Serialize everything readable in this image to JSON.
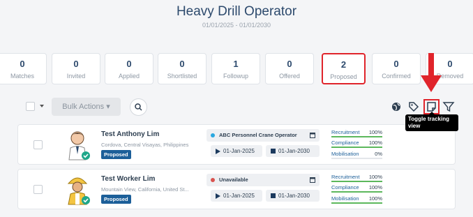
{
  "header": {
    "title": "Heavy Drill Operator",
    "date_range": "01/01/2025 - 01/01/2030"
  },
  "stats": [
    {
      "count": "0",
      "label": "Matches"
    },
    {
      "count": "0",
      "label": "Invited"
    },
    {
      "count": "0",
      "label": "Applied"
    },
    {
      "count": "0",
      "label": "Shortlisted"
    },
    {
      "count": "1",
      "label": "Followup"
    },
    {
      "count": "0",
      "label": "Offered"
    },
    {
      "count": "2",
      "label": "Proposed"
    },
    {
      "count": "0",
      "label": "Confirmed"
    },
    {
      "count": "0",
      "label": "Removed"
    }
  ],
  "toolbar": {
    "bulk_actions_label": "Bulk Actions ▾"
  },
  "tooltip": {
    "text": "Toggle tracking view"
  },
  "workers": [
    {
      "name": "Test Anthony Lim",
      "location": "Cordova, Central Visayas, Philippines",
      "status": "Proposed",
      "project": "ABC Personnel Crane Operator",
      "project_dot_color": "#29a8e0",
      "start_date": "01-Jan-2025",
      "end_date": "01-Jan-2030",
      "metrics": [
        {
          "label": "Recruitment",
          "value": "100%",
          "level": 1.0
        },
        {
          "label": "Compliance",
          "value": "100%",
          "level": 1.0
        },
        {
          "label": "Mobilisation",
          "value": "0%",
          "level": 0.0
        }
      ]
    },
    {
      "name": "Test Worker Lim",
      "location": "Mountain View, California, United St...",
      "status": "Proposed",
      "project": "Unavailable",
      "project_dot_color": "#d9534f",
      "start_date": "01-Jan-2025",
      "end_date": "01-Jan-2030",
      "metrics": [
        {
          "label": "Recruitment",
          "value": "100%",
          "level": 1.0
        },
        {
          "label": "Compliance",
          "value": "100%",
          "level": 1.0
        },
        {
          "label": "Mobilisation",
          "value": "100%",
          "level": 1.0
        }
      ]
    }
  ],
  "icons": [
    "globe-icon",
    "tag-icon",
    "tracking-view-icon",
    "filter-icon",
    "search-icon",
    "calendar-icon",
    "play-icon",
    "stop-icon",
    "verified-check-icon"
  ],
  "colors": {
    "accent": "#1c5f99",
    "highlight": "#e0242b",
    "progress": "#5cb85c"
  }
}
